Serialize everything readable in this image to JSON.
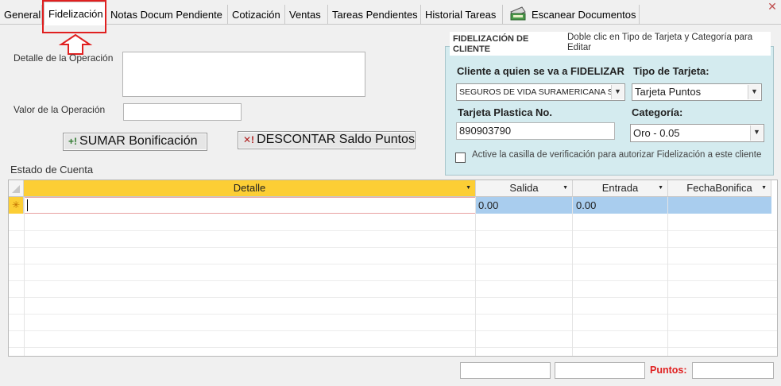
{
  "tabs": [
    {
      "label": "General"
    },
    {
      "label": "Fidelización",
      "active": true
    },
    {
      "label": "Notas Docum Pendiente"
    },
    {
      "label": "Cotización"
    },
    {
      "label": "Ventas"
    },
    {
      "label": "Tareas Pendientes"
    },
    {
      "label": "Historial Tareas"
    },
    {
      "label": "Escanear Documentos",
      "icon": "scanner-icon"
    }
  ],
  "window": {
    "close_glyph": "✕",
    "close_icon": "close-icon"
  },
  "form": {
    "detalle_label": "Detalle de la Operación",
    "detalle_value": "",
    "valor_label": "Valor de la Operación",
    "valor_value": "",
    "sumar_button": "SUMAR Bonificación",
    "sumar_icon_glyph": "+!",
    "descontar_button": "DESCONTAR Saldo Puntos",
    "descontar_icon_glyph": "✕!",
    "estado_label": "Estado de Cuenta"
  },
  "fidelizacion": {
    "title": "FIDELIZACIÓN DE CLIENTE",
    "hint": "Doble clic en Tipo de Tarjeta y Categoría para Editar",
    "cliente_label": "Cliente a quien se va a FIDELIZAR",
    "cliente_value": "SEGUROS DE VIDA SURAMERICANA S.A.",
    "tipo_label": "Tipo de Tarjeta:",
    "tipo_value": "Tarjeta Puntos",
    "tarjeta_label": "Tarjeta Plastica No.",
    "tarjeta_value": "890903790",
    "categoria_label": "Categoría:",
    "categoria_value": "Oro - 0.05",
    "checkbox_label": "Active la casilla de verificación para autorizar Fidelización a este cliente",
    "checkbox_checked": false
  },
  "grid": {
    "columns": [
      "Detalle",
      "Salida",
      "Entrada",
      "FechaBonifica"
    ],
    "new_row_marker": "✳",
    "new_row": {
      "detalle": "",
      "salida": "0.00",
      "entrada": "0.00",
      "fecha": ""
    }
  },
  "footer": {
    "total1": "",
    "total2": "",
    "puntos_label": "Puntos:",
    "puntos_value": ""
  },
  "colors": {
    "accent_red": "#e02020",
    "panel_bg": "#d4ebef",
    "grid_header": "#fcce35",
    "row_selected": "#a9cdee"
  }
}
